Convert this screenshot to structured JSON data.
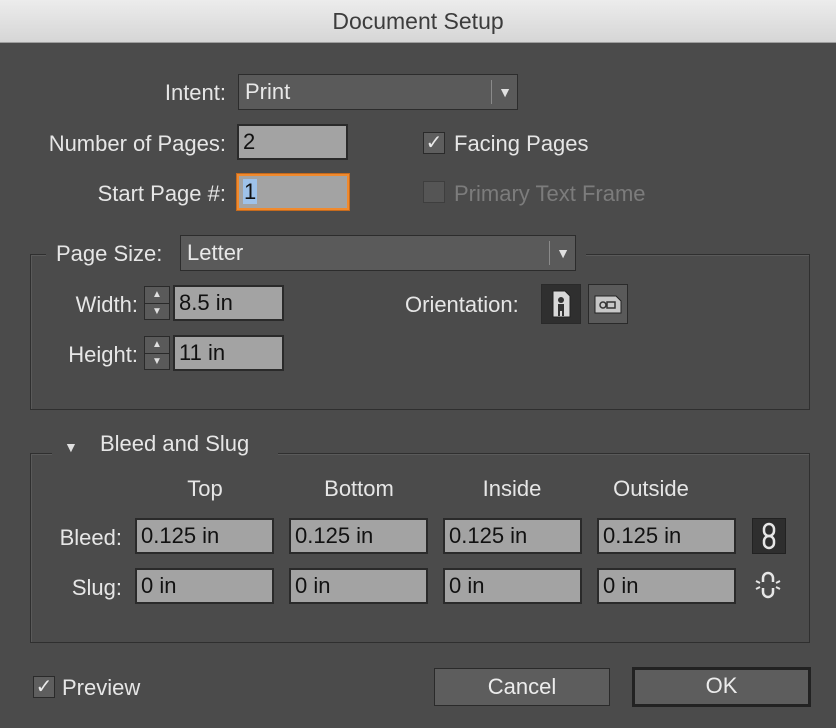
{
  "window": {
    "title": "Document Setup"
  },
  "intent": {
    "label": "Intent:",
    "value": "Print"
  },
  "pages": {
    "number_label": "Number of Pages:",
    "number_value": "2",
    "start_label": "Start Page #:",
    "start_value": "1",
    "facing_label": "Facing Pages",
    "facing_checked": true,
    "primary_label": "Primary Text Frame",
    "primary_checked": false
  },
  "page_size": {
    "label": "Page Size:",
    "value": "Letter",
    "width_label": "Width:",
    "width_value": "8.5 in",
    "height_label": "Height:",
    "height_value": "11 in",
    "orientation_label": "Orientation:"
  },
  "bleed_slug": {
    "title": "Bleed and Slug",
    "columns": [
      "Top",
      "Bottom",
      "Inside",
      "Outside"
    ],
    "bleed_label": "Bleed:",
    "bleed_values": [
      "0.125 in",
      "0.125 in",
      "0.125 in",
      "0.125 in"
    ],
    "slug_label": "Slug:",
    "slug_values": [
      "0 in",
      "0 in",
      "0 in",
      "0 in"
    ]
  },
  "footer": {
    "preview_label": "Preview",
    "preview_checked": true,
    "cancel_label": "Cancel",
    "ok_label": "OK"
  },
  "icons": {
    "dropdown_arrow": "chevron-down-icon",
    "check": "checkmark-icon",
    "orientation_portrait": "portrait-orientation-icon",
    "orientation_landscape": "landscape-orientation-icon",
    "link_chain": "link-chain-icon",
    "unlink_chain": "broken-chain-icon"
  },
  "colors": {
    "focus_border": "#f08a2e",
    "selection": "#9ec2ea",
    "dialog_bg": "#4b4b4b"
  }
}
